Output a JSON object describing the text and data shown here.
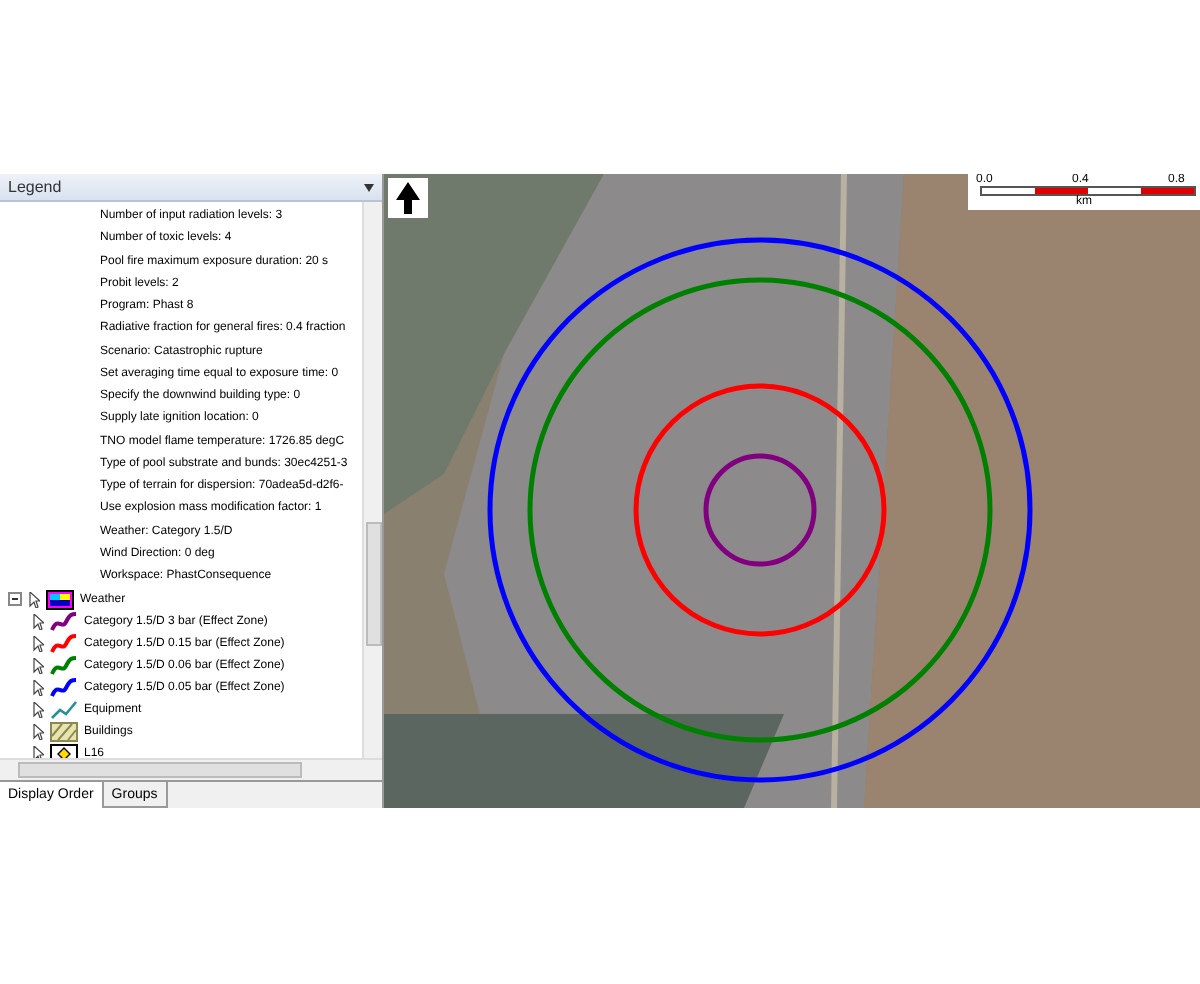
{
  "legend": {
    "title": "Legend",
    "properties": [
      "Number of input radiation levels: 3",
      "Number of toxic levels: 4",
      "Pool fire maximum exposure duration: 20 s",
      "Probit levels: 2",
      "Program: Phast 8",
      "Radiative fraction for general fires: 0.4 fraction",
      "Scenario: Catastrophic rupture",
      "Set averaging time equal to exposure time: 0",
      "Specify the downwind building type: 0",
      "Supply late ignition location: 0",
      "TNO model flame temperature: 1726.85 degC",
      "Type of pool substrate and bunds: 30ec4251-3",
      "Type of terrain for dispersion: 70adea5d-d2f6-",
      "Use explosion mass modification factor: 1",
      "Weather: Category 1.5/D",
      "Wind Direction: 0 deg",
      "Workspace: PhastConsequence"
    ],
    "layers": [
      {
        "label": "Weather",
        "kind": "weather",
        "expanded": true,
        "children": [
          {
            "label": "Category 1.5/D 3 bar (Effect Zone)",
            "kind": "zone",
            "color": "#800080"
          },
          {
            "label": "Category 1.5/D 0.15 bar (Effect Zone)",
            "kind": "zone",
            "color": "#ff0000"
          },
          {
            "label": "Category 1.5/D 0.06 bar (Effect Zone)",
            "kind": "zone",
            "color": "#008000"
          },
          {
            "label": "Category 1.5/D 0.05 bar (Effect Zone)",
            "kind": "zone",
            "color": "#0000ff"
          }
        ]
      },
      {
        "label": "Equipment",
        "kind": "equipment"
      },
      {
        "label": "Buildings",
        "kind": "buildings"
      },
      {
        "label": "L16",
        "kind": "point"
      }
    ],
    "tabs": [
      {
        "label": "Display Order",
        "selected": true
      },
      {
        "label": "Groups",
        "selected": false
      }
    ]
  },
  "map": {
    "scale": {
      "ticks": [
        "0.0",
        "0.4",
        "0.8"
      ],
      "unit": "km"
    }
  }
}
